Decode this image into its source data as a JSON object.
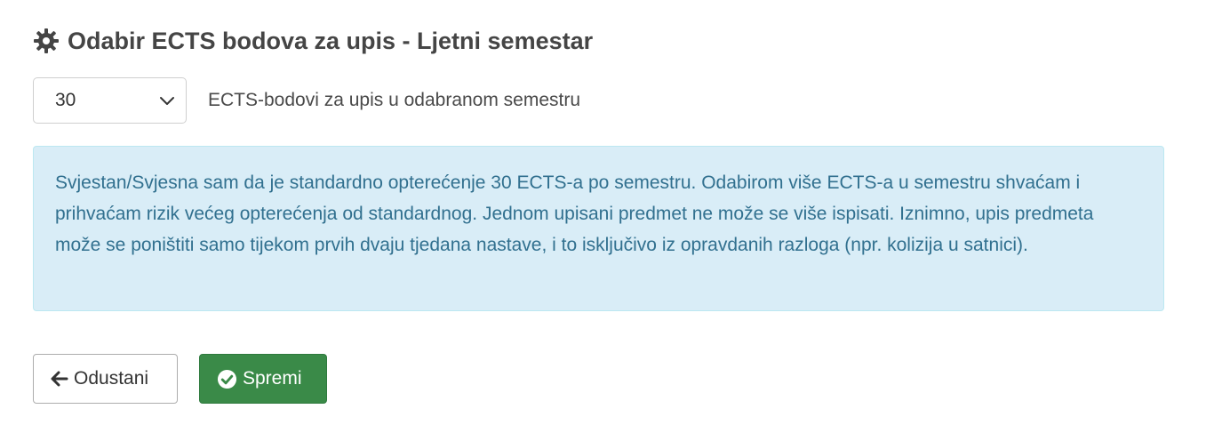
{
  "header": {
    "icon": "gear-icon",
    "title": "Odabir ECTS bodova za upis - Ljetni semestar"
  },
  "ects_select": {
    "selected_value": "30",
    "description": "ECTS-bodovi za upis u odabranom semestru"
  },
  "info_alert": {
    "text": "Svjestan/Svjesna sam da je standardno opterećenje 30 ECTS-a po semestru. Odabirom više ECTS-a u semestru shvaćam i prihvaćam rizik većeg opterećenja od standardnog. Jednom upisani predmet ne može se više ispisati. Iznimno, upis predmeta može se poništiti samo tijekom prvih dvaju tjedana nastave, i to isključivo iz opravdanih razloga (npr. kolizija u satnici)."
  },
  "buttons": {
    "cancel": {
      "label": "Odustani",
      "icon": "arrow-left-icon"
    },
    "save": {
      "label": "Spremi",
      "icon": "check-circle-icon"
    }
  },
  "colors": {
    "alert_background": "#d9edf7",
    "alert_text": "#31708f",
    "save_button": "#3a8a48"
  }
}
